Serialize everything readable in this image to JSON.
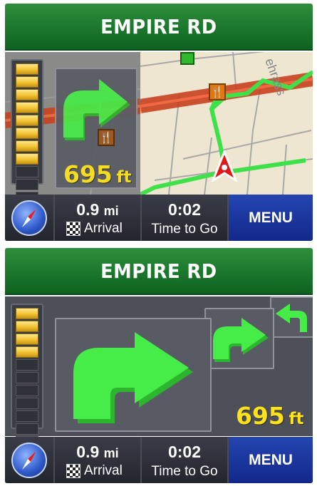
{
  "screens": [
    {
      "street_name": "EMPIRE RD",
      "lane_bars": {
        "lit": 8,
        "total": 12
      },
      "distance_to_turn": {
        "value": "695",
        "unit": "ft"
      },
      "map": {
        "street_label": "ehrass",
        "poi_icon": "fork-knife-icon"
      },
      "footer": {
        "compass_icon": "compass-icon",
        "distance": {
          "value": "0.9",
          "unit": "mi"
        },
        "arrival_label": "Arrival",
        "time": "0:02",
        "time_label": "Time to Go",
        "menu_label": "MENU"
      }
    },
    {
      "street_name": "EMPIRE RD",
      "lane_bars": {
        "lit": 4,
        "total": 12
      },
      "distance_to_turn": {
        "value": "695",
        "unit": "ft"
      },
      "footer": {
        "compass_icon": "compass-icon",
        "distance": {
          "value": "0.9",
          "unit": "mi"
        },
        "arrival_label": "Arrival",
        "time": "0:02",
        "time_label": "Time to Go",
        "menu_label": "MENU"
      }
    }
  ],
  "colors": {
    "header_green": "#1d7a2e",
    "route_green": "#3fe04a",
    "distance_yellow": "#ffe21a",
    "menu_blue": "#1a36a0",
    "route_red": "#d42a1a"
  }
}
